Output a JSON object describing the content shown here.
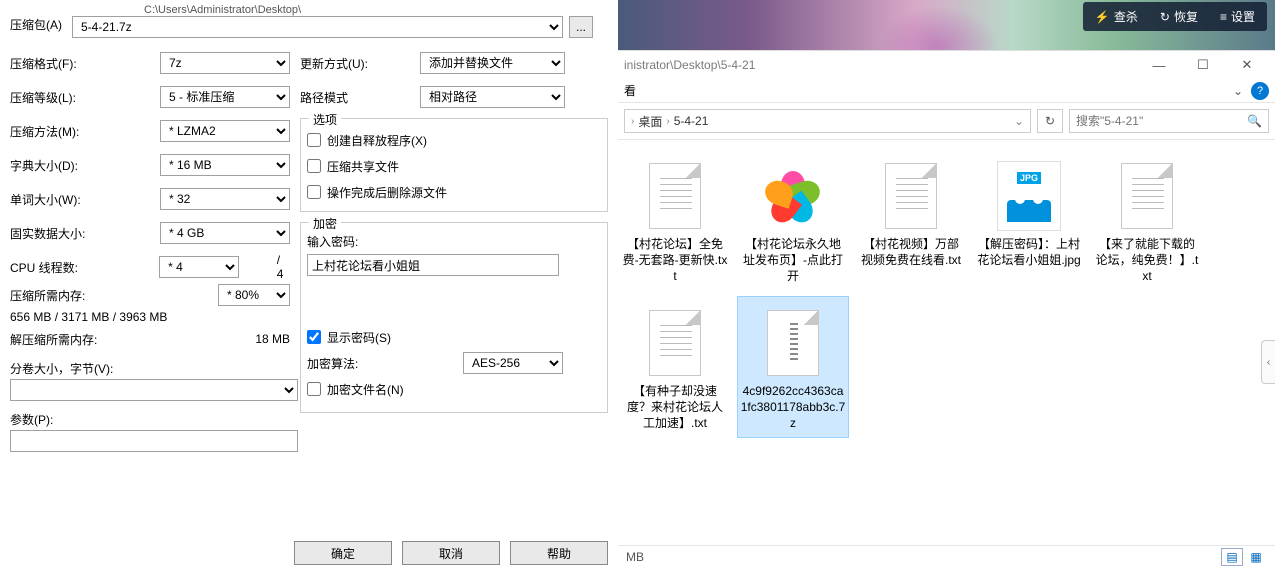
{
  "archive": {
    "label": "压缩包(A)",
    "path": "C:\\Users\\Administrator\\Desktop\\",
    "filename": "5-4-21.7z",
    "browse": "..."
  },
  "left": {
    "format_label": "压缩格式(F):",
    "format": "7z",
    "level_label": "压缩等级(L):",
    "level": "5 - 标准压缩",
    "method_label": "压缩方法(M):",
    "method": "* LZMA2",
    "dict_label": "字典大小(D):",
    "dict": "* 16 MB",
    "word_label": "单词大小(W):",
    "word": "* 32",
    "solid_label": "固实数据大小:",
    "solid": "* 4 GB",
    "cpu_label": "CPU 线程数:",
    "cpu": "* 4",
    "cpu_max": "/ 4",
    "compress_mem_label": "压缩所需内存:",
    "mem_pct": "* 80%",
    "compress_mem_val": "656 MB / 3171 MB / 3963 MB",
    "decompress_mem_label": "解压缩所需内存:",
    "decompress_mem_val": "18 MB",
    "split_label": "分卷大小，字节(V):",
    "param_label": "参数(P):"
  },
  "right": {
    "update_label": "更新方式(U):",
    "update": "添加并替换文件",
    "pathmode_label": "路径模式",
    "pathmode": "相对路径",
    "options_group": "选项",
    "sfx": "创建自释放程序(X)",
    "share": "压缩共享文件",
    "delete_after": "操作完成后删除源文件",
    "encrypt_group": "加密",
    "pw_label": "输入密码:",
    "pw_value": "上村花论坛看小姐姐",
    "show_pw": "显示密码(S)",
    "enc_method_label": "加密算法:",
    "enc_method": "AES-256",
    "enc_names": "加密文件名(N)"
  },
  "buttons": {
    "ok": "确定",
    "cancel": "取消",
    "help": "帮助"
  },
  "tray": {
    "scan": "查杀",
    "restore": "恢复",
    "settings": "设置"
  },
  "explorer": {
    "title": "inistrator\\Desktop\\5-4-21",
    "menu_visible": "看",
    "crumb_desktop": "桌面",
    "crumb_folder": "5-4-21",
    "search_placeholder": "搜索\"5-4-21\"",
    "status": "MB",
    "files": [
      {
        "name": "【村花论坛】全免费-无套路-更新快.txt",
        "type": "txt"
      },
      {
        "name": "【村花论坛永久地址发布页】-点此打开",
        "type": "pin"
      },
      {
        "name": "【村花视频】万部视频免费在线看.txt",
        "type": "txt"
      },
      {
        "name": "【解压密码】：上村花论坛看小姐姐.jpg",
        "type": "jpg"
      },
      {
        "name": "【来了就能下载的论坛，纯免费！】.txt",
        "type": "txt"
      },
      {
        "name": "【有种子却没速度？来村花论坛人工加速】.txt",
        "type": "txt"
      },
      {
        "name": "4c9f9262cc4363ca1fc3801178abb3c.7z",
        "type": "7z",
        "selected": true
      }
    ]
  }
}
